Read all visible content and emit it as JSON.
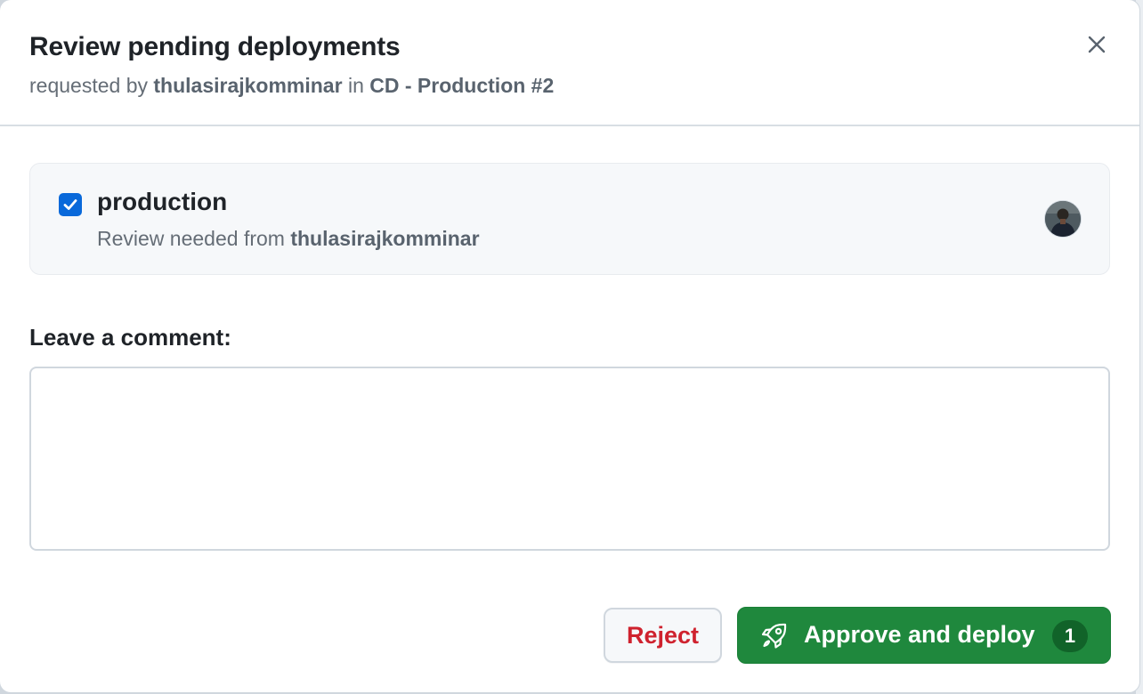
{
  "dialog": {
    "title": "Review pending deployments",
    "subtitle_prefix": "requested by",
    "requester": "thulasirajkomminar",
    "subtitle_in": "in",
    "workflow_run": "CD - Production #2",
    "close_icon": "close-icon"
  },
  "environment": {
    "name": "production",
    "checked": true,
    "review_prefix": "Review needed from",
    "reviewer": "thulasirajkomminar",
    "avatar_icon": "user-avatar"
  },
  "comment": {
    "label": "Leave a comment:",
    "value": "",
    "placeholder": ""
  },
  "actions": {
    "reject_label": "Reject",
    "approve_label": "Approve and deploy",
    "approve_count": "1",
    "approve_icon": "rocket-icon"
  },
  "colors": {
    "primary_green": "#1f883d",
    "danger_red": "#cf222e",
    "checkbox_blue": "#0969da",
    "muted_text": "#656d76"
  }
}
